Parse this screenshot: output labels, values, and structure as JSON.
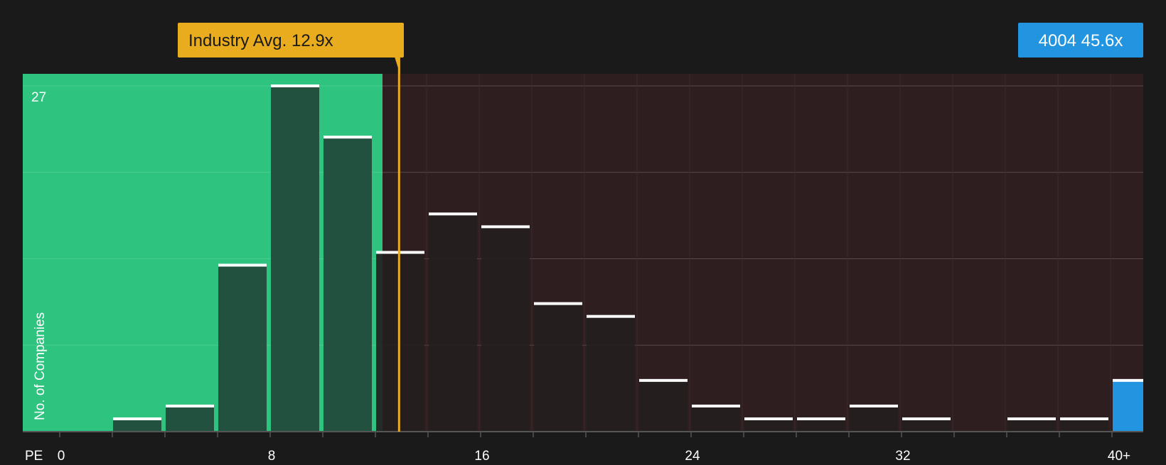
{
  "chart_data": {
    "type": "bar",
    "xlabel": "PE",
    "ylabel": "No. of Companies",
    "ylim": [
      0,
      27
    ],
    "y_tick_label": "27",
    "x_tick_labels": [
      "0",
      "8",
      "16",
      "24",
      "32",
      "40+"
    ],
    "x_tick_values": [
      0,
      8,
      16,
      24,
      32,
      40
    ],
    "bin_width": 2,
    "bins": [
      {
        "x0": 0,
        "value": 0
      },
      {
        "x0": 2,
        "value": 1
      },
      {
        "x0": 4,
        "value": 2
      },
      {
        "x0": 6,
        "value": 13
      },
      {
        "x0": 8,
        "value": 27
      },
      {
        "x0": 10,
        "value": 23
      },
      {
        "x0": 12,
        "value": 14
      },
      {
        "x0": 14,
        "value": 17
      },
      {
        "x0": 16,
        "value": 16
      },
      {
        "x0": 18,
        "value": 10
      },
      {
        "x0": 20,
        "value": 9
      },
      {
        "x0": 22,
        "value": 4
      },
      {
        "x0": 24,
        "value": 2
      },
      {
        "x0": 26,
        "value": 1
      },
      {
        "x0": 28,
        "value": 1
      },
      {
        "x0": 30,
        "value": 2
      },
      {
        "x0": 32,
        "value": 1
      },
      {
        "x0": 34,
        "value": 0
      },
      {
        "x0": 36,
        "value": 1
      },
      {
        "x0": 38,
        "value": 1
      },
      {
        "x0": 40,
        "value": 4,
        "highlight": true
      }
    ],
    "industry_avg": {
      "label": "Industry Avg. 12.9x",
      "value": 12.9
    },
    "company": {
      "label": "4004 45.6x",
      "value": 45.6
    },
    "colors": {
      "background": "#1a1a1a",
      "below_avg_zone": "#2ec47f",
      "above_avg_zone": "#2f1e1f",
      "bar_below": "#22463a",
      "bar_above": "#241e1f",
      "bar_cap": "#ffffff",
      "avg_line": "#e8ac1e",
      "avg_badge": "#e8ac1e",
      "company_badge": "#2394e0",
      "company_bar": "#2394e0",
      "text": "#ffffff",
      "grid": "#5a4a4b",
      "axis": "#555555"
    }
  }
}
